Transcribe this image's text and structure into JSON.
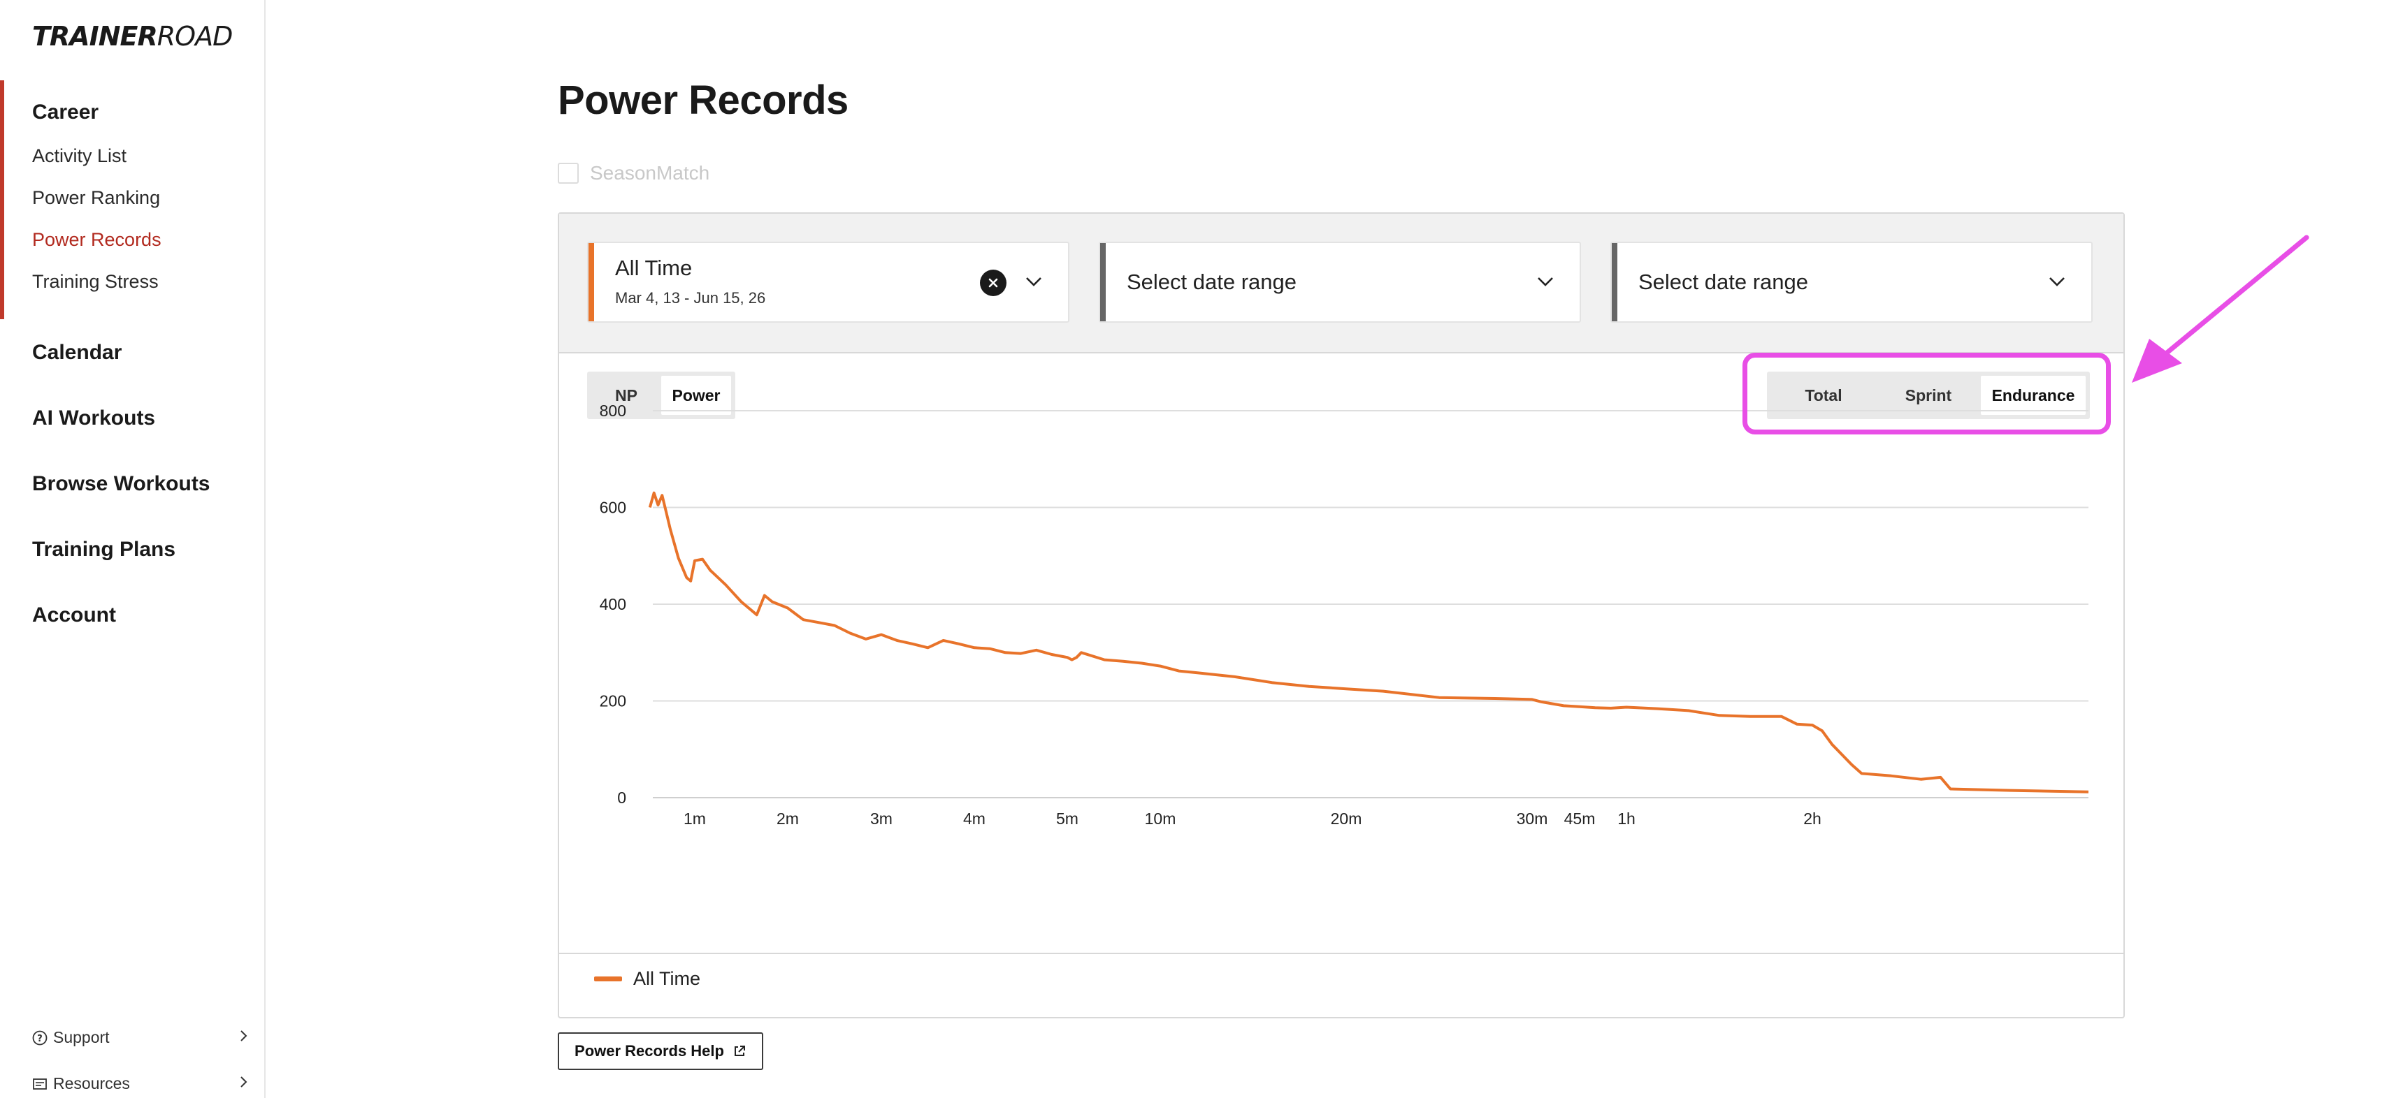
{
  "brand": {
    "logo_bold": "TRAINER",
    "logo_light": "ROAD"
  },
  "sidebar": {
    "career": "Career",
    "career_items": [
      {
        "label": "Activity List",
        "active": false
      },
      {
        "label": "Power Ranking",
        "active": false
      },
      {
        "label": "Power Records",
        "active": true
      },
      {
        "label": "Training Stress",
        "active": false
      }
    ],
    "sections": [
      "Calendar",
      "AI Workouts",
      "Browse Workouts",
      "Training Plans",
      "Account"
    ],
    "bottom": [
      {
        "label": "Support",
        "icon": "help-circle-icon"
      },
      {
        "label": "Resources",
        "icon": "resources-icon"
      }
    ]
  },
  "main": {
    "title": "Power Records",
    "seasonmatch_label": "SeasonMatch",
    "selectors": [
      {
        "main": "All Time",
        "sub": "Mar 4, 13 - Jun 15, 26",
        "accent": "#e8732a",
        "clearable": true
      },
      {
        "main": "Select date range",
        "sub": "",
        "accent": "#666666",
        "clearable": false
      },
      {
        "main": "Select date range",
        "sub": "",
        "accent": "#666666",
        "clearable": false
      }
    ],
    "metric_toggle": {
      "options": [
        "NP",
        "Power"
      ],
      "selected": "Power"
    },
    "type_toggle": {
      "options": [
        "Total",
        "Sprint",
        "Endurance"
      ],
      "selected": "Endurance"
    },
    "legend": "All Time",
    "help_button": "Power Records Help"
  },
  "colors": {
    "accent_orange": "#e8732a",
    "active_nav_red": "#b22a1f",
    "annotation_magenta": "#e84ee6"
  },
  "chart_data": {
    "type": "line",
    "ylim": [
      0,
      800
    ],
    "yticks": [
      0,
      200,
      400,
      600,
      800
    ],
    "xtick_labels": [
      "1m",
      "2m",
      "3m",
      "4m",
      "5m",
      "10m",
      "20m",
      "30m",
      "45m",
      "1h",
      "2h"
    ],
    "series": [
      {
        "name": "All Time",
        "color": "#e8732a",
        "points": [
          [
            "0:05",
            600
          ],
          [
            "0:10",
            630
          ],
          [
            "0:15",
            605
          ],
          [
            "0:20",
            625
          ],
          [
            "0:25",
            590
          ],
          [
            "0:30",
            555
          ],
          [
            "0:40",
            495
          ],
          [
            "0:50",
            455
          ],
          [
            "0:55",
            448
          ],
          [
            "1:00",
            490
          ],
          [
            "1:05",
            493
          ],
          [
            "1:10",
            470
          ],
          [
            "1:20",
            440
          ],
          [
            "1:30",
            405
          ],
          [
            "1:40",
            378
          ],
          [
            "1:45",
            418
          ],
          [
            "1:50",
            405
          ],
          [
            "2:00",
            392
          ],
          [
            "2:10",
            368
          ],
          [
            "2:20",
            362
          ],
          [
            "2:30",
            356
          ],
          [
            "2:40",
            340
          ],
          [
            "2:50",
            328
          ],
          [
            "3:00",
            337
          ],
          [
            "3:10",
            325
          ],
          [
            "3:20",
            318
          ],
          [
            "3:30",
            310
          ],
          [
            "3:40",
            325
          ],
          [
            "3:50",
            318
          ],
          [
            "4:00",
            310
          ],
          [
            "4:10",
            308
          ],
          [
            "4:20",
            300
          ],
          [
            "4:30",
            298
          ],
          [
            "4:40",
            305
          ],
          [
            "4:50",
            296
          ],
          [
            "5:00",
            290
          ],
          [
            "5:15",
            285
          ],
          [
            "5:30",
            290
          ],
          [
            "5:45",
            300
          ],
          [
            "6:00",
            297
          ],
          [
            "7:00",
            285
          ],
          [
            "8:00",
            282
          ],
          [
            "9:00",
            278
          ],
          [
            "10:00",
            272
          ],
          [
            "11:00",
            262
          ],
          [
            "12:00",
            258
          ],
          [
            "14:00",
            250
          ],
          [
            "16:00",
            238
          ],
          [
            "18:00",
            230
          ],
          [
            "20:00",
            225
          ],
          [
            "22:00",
            220
          ],
          [
            "25:00",
            207
          ],
          [
            "28:00",
            205
          ],
          [
            "30:00",
            203
          ],
          [
            "33:00",
            198
          ],
          [
            "40:00",
            190
          ],
          [
            "45:00",
            188
          ],
          [
            "50:00",
            186
          ],
          [
            "55:00",
            185
          ],
          [
            "60:00",
            187
          ],
          [
            "70:00",
            184
          ],
          [
            "80:00",
            180
          ],
          [
            "90:00",
            170
          ],
          [
            "100:00",
            168
          ],
          [
            "110:00",
            168
          ],
          [
            "115:00",
            152
          ],
          [
            "120:00",
            150
          ],
          [
            "125:00",
            138
          ],
          [
            "130:00",
            110
          ],
          [
            "140:00",
            68
          ],
          [
            "145:00",
            50
          ],
          [
            "160:00",
            45
          ],
          [
            "175:00",
            38
          ],
          [
            "185:00",
            42
          ],
          [
            "190:00",
            18
          ],
          [
            "220:00",
            15
          ],
          [
            "260:00",
            12
          ]
        ]
      }
    ],
    "grid": true,
    "legend_position": "bottom-left"
  }
}
